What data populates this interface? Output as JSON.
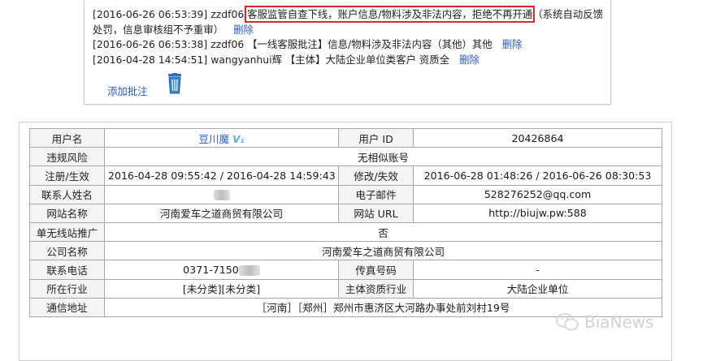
{
  "notes": {
    "entries": [
      {
        "prefix": "[2016-06-26 06:53:39] zzdf06 ",
        "highlight": "客服监管自查下线，账户信息/物料涉及非法内容，拒绝不再开通",
        "suffix": "（系统自动反馈处罚，信息审核组不予重审）",
        "action": "删除"
      },
      {
        "text": "[2016-06-26 06:53:38] zzdf06 【一线客服批注】信息/物料涉及非法内容（其他）其他",
        "action": "删除"
      },
      {
        "text": "[2016-04-28 14:54:51] wangyanhui辉 【主体】大陆企业单位类客户 资质全",
        "action": "删除"
      }
    ],
    "add_label": "添加批注"
  },
  "info": {
    "rows": [
      [
        "用户名",
        "豆川魔",
        "用户 ID",
        "20426864"
      ],
      [
        "违规风险",
        "无相似账号"
      ],
      [
        "注册/生效",
        "2016-04-28 09:55:42 / 2016-04-28 14:59:43",
        "修改/失效",
        "2016-06-28 01:48:26 / 2016-06-26 08:30:53"
      ],
      [
        "联系人姓名",
        "",
        "电子邮件",
        "528276252@qq.com"
      ],
      [
        "网站名称",
        "河南爱车之道商贸有限公司",
        "网站 URL",
        "http://biujw.pw:588"
      ],
      [
        "单无线站推广",
        "否"
      ],
      [
        "公司名称",
        "河南爱车之道商贸有限公司"
      ],
      [
        "联系电话",
        "0371-7150",
        "传真号码",
        "-"
      ],
      [
        "所在行业",
        "[未分类][未分类]",
        "主体资质行业",
        "大陆企业单位"
      ],
      [
        "通信地址",
        "［河南］［郑州］郑州市惠济区大河路办事处前刘村19号"
      ]
    ],
    "vip_badge": "V₁"
  },
  "watermark": "BiaNews",
  "colors": {
    "highlight": "#d8262c",
    "link": "#2a5bc2",
    "border": "#a7a7a7",
    "label_bg": "#f4f4f4"
  },
  "icons": [
    "trash-icon",
    "wechat-icon"
  ]
}
